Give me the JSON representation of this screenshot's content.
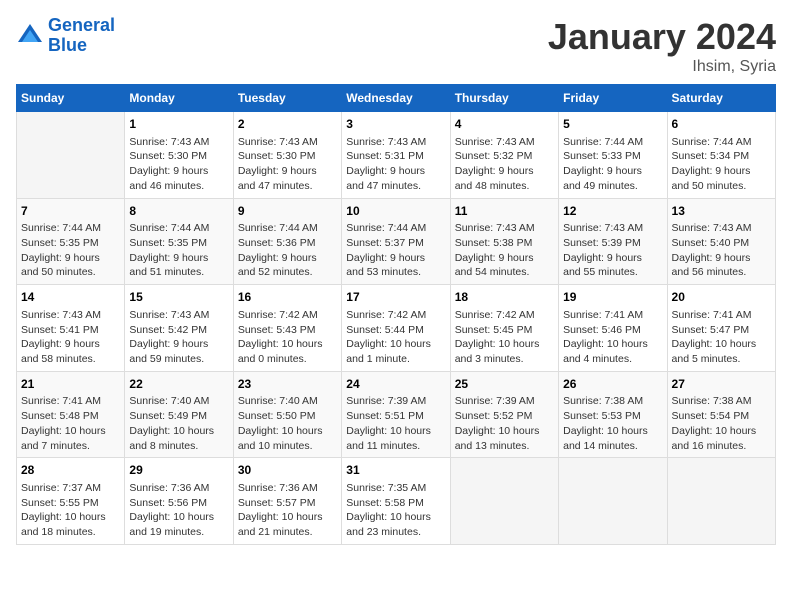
{
  "logo": {
    "line1": "General",
    "line2": "Blue"
  },
  "title": "January 2024",
  "subtitle": "Ihsim, Syria",
  "headers": [
    "Sunday",
    "Monday",
    "Tuesday",
    "Wednesday",
    "Thursday",
    "Friday",
    "Saturday"
  ],
  "weeks": [
    [
      {
        "day": "",
        "content": ""
      },
      {
        "day": "1",
        "content": "Sunrise: 7:43 AM\nSunset: 5:30 PM\nDaylight: 9 hours\nand 46 minutes."
      },
      {
        "day": "2",
        "content": "Sunrise: 7:43 AM\nSunset: 5:30 PM\nDaylight: 9 hours\nand 47 minutes."
      },
      {
        "day": "3",
        "content": "Sunrise: 7:43 AM\nSunset: 5:31 PM\nDaylight: 9 hours\nand 47 minutes."
      },
      {
        "day": "4",
        "content": "Sunrise: 7:43 AM\nSunset: 5:32 PM\nDaylight: 9 hours\nand 48 minutes."
      },
      {
        "day": "5",
        "content": "Sunrise: 7:44 AM\nSunset: 5:33 PM\nDaylight: 9 hours\nand 49 minutes."
      },
      {
        "day": "6",
        "content": "Sunrise: 7:44 AM\nSunset: 5:34 PM\nDaylight: 9 hours\nand 50 minutes."
      }
    ],
    [
      {
        "day": "7",
        "content": "Sunrise: 7:44 AM\nSunset: 5:35 PM\nDaylight: 9 hours\nand 50 minutes."
      },
      {
        "day": "8",
        "content": "Sunrise: 7:44 AM\nSunset: 5:35 PM\nDaylight: 9 hours\nand 51 minutes."
      },
      {
        "day": "9",
        "content": "Sunrise: 7:44 AM\nSunset: 5:36 PM\nDaylight: 9 hours\nand 52 minutes."
      },
      {
        "day": "10",
        "content": "Sunrise: 7:44 AM\nSunset: 5:37 PM\nDaylight: 9 hours\nand 53 minutes."
      },
      {
        "day": "11",
        "content": "Sunrise: 7:43 AM\nSunset: 5:38 PM\nDaylight: 9 hours\nand 54 minutes."
      },
      {
        "day": "12",
        "content": "Sunrise: 7:43 AM\nSunset: 5:39 PM\nDaylight: 9 hours\nand 55 minutes."
      },
      {
        "day": "13",
        "content": "Sunrise: 7:43 AM\nSunset: 5:40 PM\nDaylight: 9 hours\nand 56 minutes."
      }
    ],
    [
      {
        "day": "14",
        "content": "Sunrise: 7:43 AM\nSunset: 5:41 PM\nDaylight: 9 hours\nand 58 minutes."
      },
      {
        "day": "15",
        "content": "Sunrise: 7:43 AM\nSunset: 5:42 PM\nDaylight: 9 hours\nand 59 minutes."
      },
      {
        "day": "16",
        "content": "Sunrise: 7:42 AM\nSunset: 5:43 PM\nDaylight: 10 hours\nand 0 minutes."
      },
      {
        "day": "17",
        "content": "Sunrise: 7:42 AM\nSunset: 5:44 PM\nDaylight: 10 hours\nand 1 minute."
      },
      {
        "day": "18",
        "content": "Sunrise: 7:42 AM\nSunset: 5:45 PM\nDaylight: 10 hours\nand 3 minutes."
      },
      {
        "day": "19",
        "content": "Sunrise: 7:41 AM\nSunset: 5:46 PM\nDaylight: 10 hours\nand 4 minutes."
      },
      {
        "day": "20",
        "content": "Sunrise: 7:41 AM\nSunset: 5:47 PM\nDaylight: 10 hours\nand 5 minutes."
      }
    ],
    [
      {
        "day": "21",
        "content": "Sunrise: 7:41 AM\nSunset: 5:48 PM\nDaylight: 10 hours\nand 7 minutes."
      },
      {
        "day": "22",
        "content": "Sunrise: 7:40 AM\nSunset: 5:49 PM\nDaylight: 10 hours\nand 8 minutes."
      },
      {
        "day": "23",
        "content": "Sunrise: 7:40 AM\nSunset: 5:50 PM\nDaylight: 10 hours\nand 10 minutes."
      },
      {
        "day": "24",
        "content": "Sunrise: 7:39 AM\nSunset: 5:51 PM\nDaylight: 10 hours\nand 11 minutes."
      },
      {
        "day": "25",
        "content": "Sunrise: 7:39 AM\nSunset: 5:52 PM\nDaylight: 10 hours\nand 13 minutes."
      },
      {
        "day": "26",
        "content": "Sunrise: 7:38 AM\nSunset: 5:53 PM\nDaylight: 10 hours\nand 14 minutes."
      },
      {
        "day": "27",
        "content": "Sunrise: 7:38 AM\nSunset: 5:54 PM\nDaylight: 10 hours\nand 16 minutes."
      }
    ],
    [
      {
        "day": "28",
        "content": "Sunrise: 7:37 AM\nSunset: 5:55 PM\nDaylight: 10 hours\nand 18 minutes."
      },
      {
        "day": "29",
        "content": "Sunrise: 7:36 AM\nSunset: 5:56 PM\nDaylight: 10 hours\nand 19 minutes."
      },
      {
        "day": "30",
        "content": "Sunrise: 7:36 AM\nSunset: 5:57 PM\nDaylight: 10 hours\nand 21 minutes."
      },
      {
        "day": "31",
        "content": "Sunrise: 7:35 AM\nSunset: 5:58 PM\nDaylight: 10 hours\nand 23 minutes."
      },
      {
        "day": "",
        "content": ""
      },
      {
        "day": "",
        "content": ""
      },
      {
        "day": "",
        "content": ""
      }
    ]
  ]
}
